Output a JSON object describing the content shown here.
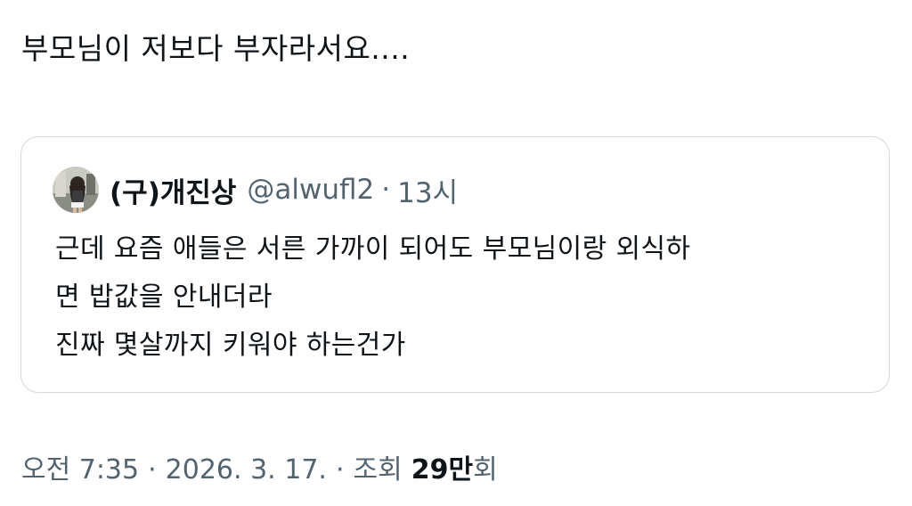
{
  "tweet": {
    "text": "부모님이 저보다 부자라서요...."
  },
  "quote": {
    "author_name": "(구)개진상",
    "author_handle": "@alwufl2",
    "separator": "·",
    "time": "13시",
    "avatar_icon": "profile-photo",
    "lines": [
      "근데 요즘 애들은 서른 가까이 되어도 부모님이랑 외식하",
      "면 밥값을 안내더라",
      "진짜 몇살까지 키워야 하는건가"
    ]
  },
  "meta": {
    "time": "오전 7:35",
    "separator": "·",
    "date": "2026. 3. 17.",
    "views_label": "조회",
    "views_count": "29만",
    "views_suffix": "회"
  },
  "colors": {
    "text_primary": "#0f1419",
    "text_secondary": "#536471",
    "border": "#cfd9de"
  }
}
